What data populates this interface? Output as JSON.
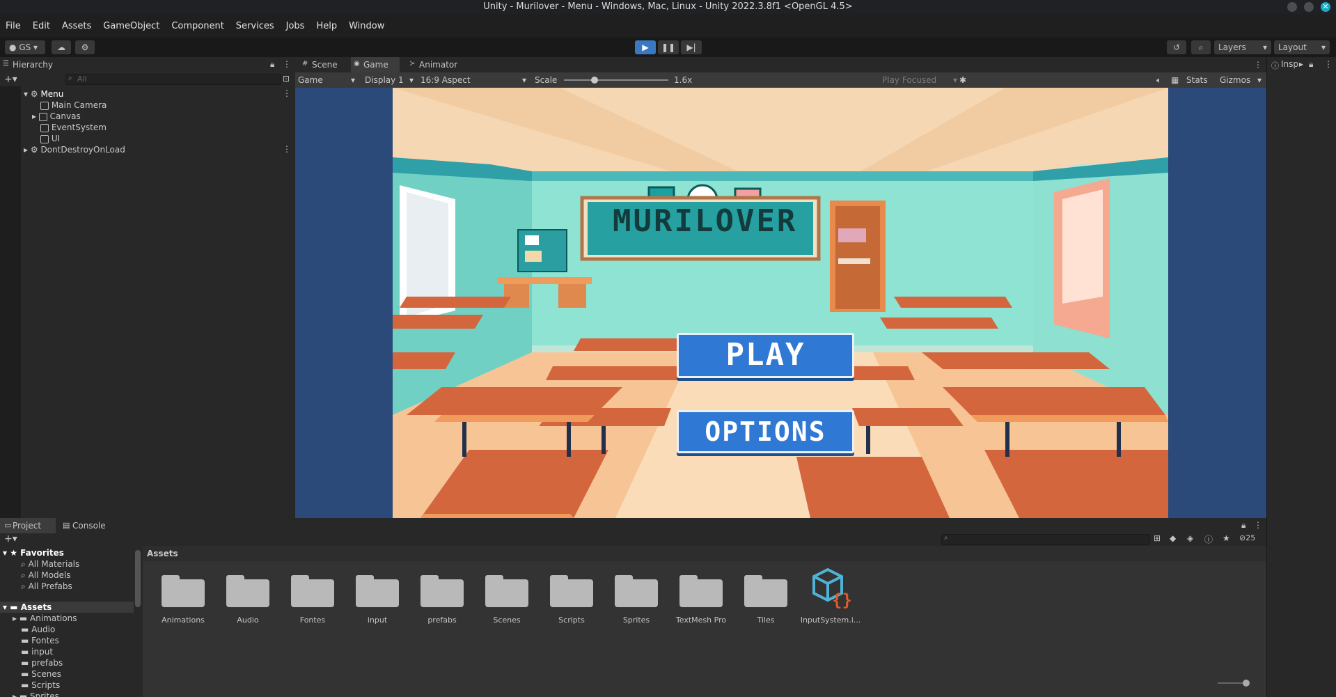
{
  "window": {
    "title": "Unity - Murilover - Menu - Windows, Mac, Linux - Unity 2022.3.8f1 <OpenGL 4.5>"
  },
  "menu": [
    "File",
    "Edit",
    "Assets",
    "GameObject",
    "Component",
    "Services",
    "Jobs",
    "Help",
    "Window"
  ],
  "toolbar": {
    "account": "GS",
    "layers": "Layers",
    "layout": "Layout"
  },
  "hierarchy": {
    "tab": "Hierarchy",
    "search_placeholder": "All",
    "items": [
      {
        "label": "Menu"
      },
      {
        "label": "Main Camera"
      },
      {
        "label": "Canvas"
      },
      {
        "label": "EventSystem"
      },
      {
        "label": "UI"
      },
      {
        "label": "DontDestroyOnLoad"
      }
    ]
  },
  "scene_tabs": [
    "Scene",
    "Game",
    "Animator"
  ],
  "game_bar": {
    "mode": "Game",
    "display": "Display 1",
    "aspect": "16:9 Aspect",
    "scale_label": "Scale",
    "scale_value": "1.6x",
    "play_mode": "Play Focused",
    "stats": "Stats",
    "gizmos": "Gizmos"
  },
  "game_view": {
    "title": "MURILOVER",
    "play_button": "PLAY",
    "options_button": "OPTIONS"
  },
  "inspector": {
    "tab": "Insp"
  },
  "project": {
    "tabs": [
      "Project",
      "Console"
    ],
    "breadcrumb": "Assets",
    "hidden_count": "25",
    "favorites": {
      "label": "Favorites",
      "items": [
        "All Materials",
        "All Models",
        "All Prefabs"
      ]
    },
    "assets_tree": {
      "label": "Assets",
      "items": [
        "Animations",
        "Audio",
        "Fontes",
        "input",
        "prefabs",
        "Scenes",
        "Scripts",
        "Sprites"
      ]
    },
    "grid": [
      "Animations",
      "Audio",
      "Fontes",
      "input",
      "prefabs",
      "Scenes",
      "Scripts",
      "Sprites",
      "TextMesh Pro",
      "Tiles",
      "InputSystem.i..."
    ]
  },
  "colors": {
    "play_active": "#3a78c4",
    "game_bg": "#2b4a79",
    "button_blue": "#2f78d4"
  }
}
